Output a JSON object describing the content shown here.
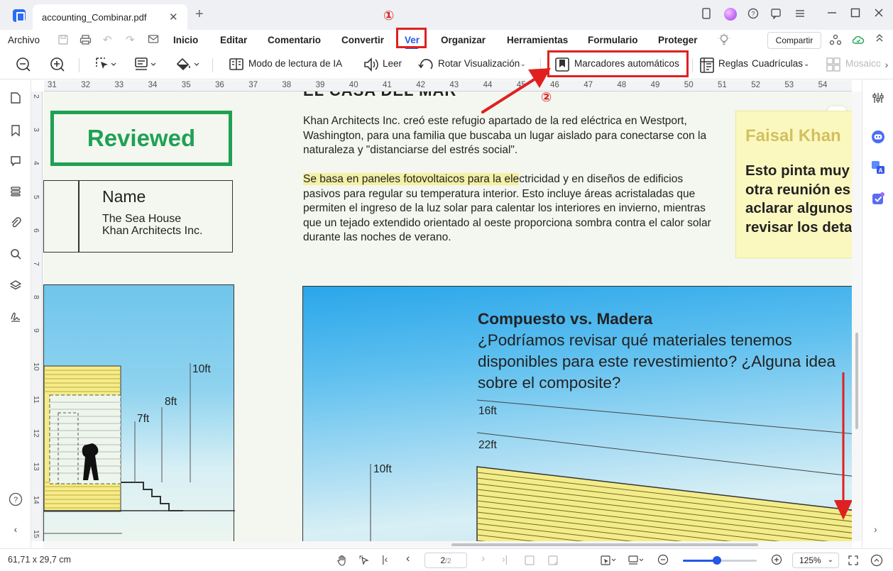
{
  "titlebar": {
    "tab_title": "accounting_Combinar.pdf",
    "close_glyph": "✕",
    "new_tab_glyph": "+",
    "icons": [
      "bookmark-icon",
      "avatar",
      "help-icon",
      "feedback-icon",
      "menu-icon",
      "minimize-icon",
      "maximize-icon",
      "close-icon"
    ]
  },
  "menubar": {
    "archivo": "Archivo",
    "items": [
      "Inicio",
      "Editar",
      "Comentario",
      "Convertir",
      "Ver",
      "Organizar",
      "Herramientas",
      "Formulario",
      "Proteger"
    ],
    "active_item": "Ver",
    "share": "Compartir"
  },
  "toolbar": {
    "ai_reading": "Modo de lectura de IA",
    "read": "Leer",
    "rotate": "Rotar Visualización",
    "auto_bookmarks": "Marcadores automáticos",
    "rulers": "Reglas",
    "grids": "Cuadrículas",
    "tiles": "Mosaicos"
  },
  "ruler": {
    "h_numbers": [
      "31",
      "32",
      "33",
      "34",
      "35",
      "36",
      "37",
      "38",
      "39",
      "40",
      "41",
      "42",
      "43",
      "44",
      "45",
      "46",
      "47",
      "48",
      "49",
      "50",
      "51",
      "52",
      "53",
      "54"
    ],
    "v_numbers": [
      "2",
      "3",
      "4",
      "5",
      "6",
      "7",
      "8",
      "9",
      "10",
      "11",
      "12",
      "13",
      "14",
      "15"
    ]
  },
  "document": {
    "cut_heading": "EL CASA DEL MAR",
    "stamp": "Reviewed",
    "name_title": "Name",
    "name_line1": "The Sea House",
    "name_line2": "Khan Architects Inc.",
    "para1": "Khan Architects Inc. creó este refugio apartado de la red eléctrica en Westport, Washington, para una familia que buscaba un lugar aislado para conectarse con la naturaleza y \"distanciarse del estrés social\".",
    "para2_highlight": "Se basa en paneles fotovoltaicos para la ele",
    "para2_rest": "ctricidad y en diseños de edificios pasivos para regular su temperatura interior. Esto incluye áreas acristaladas que permiten el ingreso de la luz solar para calentar los interiores en invierno, mientras que un tejado extendido orientado al oeste proporciona sombra contra el calor solar durante las noches de verano.",
    "sticky_author": "Faisal Khan",
    "sticky_lines": [
      "Esto pinta muy",
      "otra reunión es",
      "aclarar algunos",
      "revisar los deta"
    ],
    "cvm_title": "Compuesto vs. Madera",
    "cvm_body": "¿Podríamos revisar qué materiales tenemos disponibles para este revestimiento? ¿Alguna idea sobre el composite?",
    "dims_left": [
      "10ft",
      "8ft",
      "7ft"
    ],
    "dims_right": [
      "16ft",
      "22ft",
      "10ft"
    ]
  },
  "annotations": {
    "step1": "①",
    "step2": "②",
    "color": "#e02020"
  },
  "statusbar": {
    "dimensions": "61,71 x 29,7 cm",
    "page_current": "2",
    "page_total": "/2",
    "zoom": "125%",
    "zoom_fraction": 0.46
  },
  "colors": {
    "accent": "#2457e8",
    "stamp_green": "#1ea153",
    "highlight": "#f4f0a4",
    "sticky_bg": "#fbf8bf"
  }
}
